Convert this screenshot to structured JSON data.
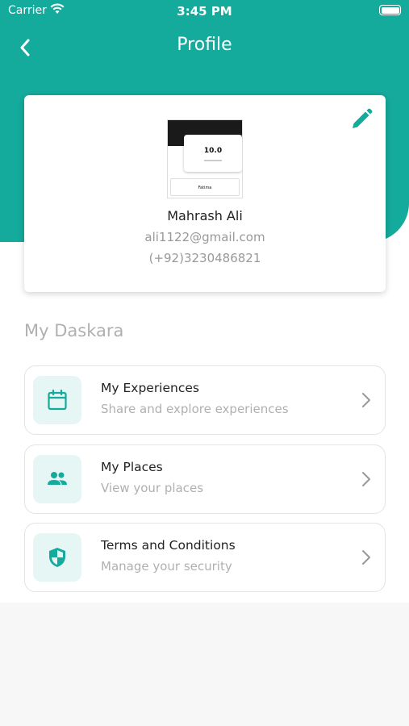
{
  "status_bar": {
    "carrier": "Carrier",
    "time": "3:45 PM"
  },
  "header": {
    "title": "Profile"
  },
  "profile": {
    "name": "Mahrash Ali",
    "email": "ali1122@gmail.com",
    "phone": "(+92)3230486821",
    "avatar_score": "10.0",
    "avatar_name": "Fatima"
  },
  "section": {
    "title": "My Daskara"
  },
  "menu": [
    {
      "label": "My Experiences",
      "subtitle": "Share and explore experiences",
      "icon": "calendar-icon"
    },
    {
      "label": "My Places",
      "subtitle": "View your places",
      "icon": "people-icon"
    },
    {
      "label": "Terms and Conditions",
      "subtitle": "Manage your security",
      "icon": "shield-icon"
    }
  ],
  "colors": {
    "accent": "#14aa9c",
    "icon_bg": "#e6f6f4",
    "muted": "#b0b0b0"
  }
}
